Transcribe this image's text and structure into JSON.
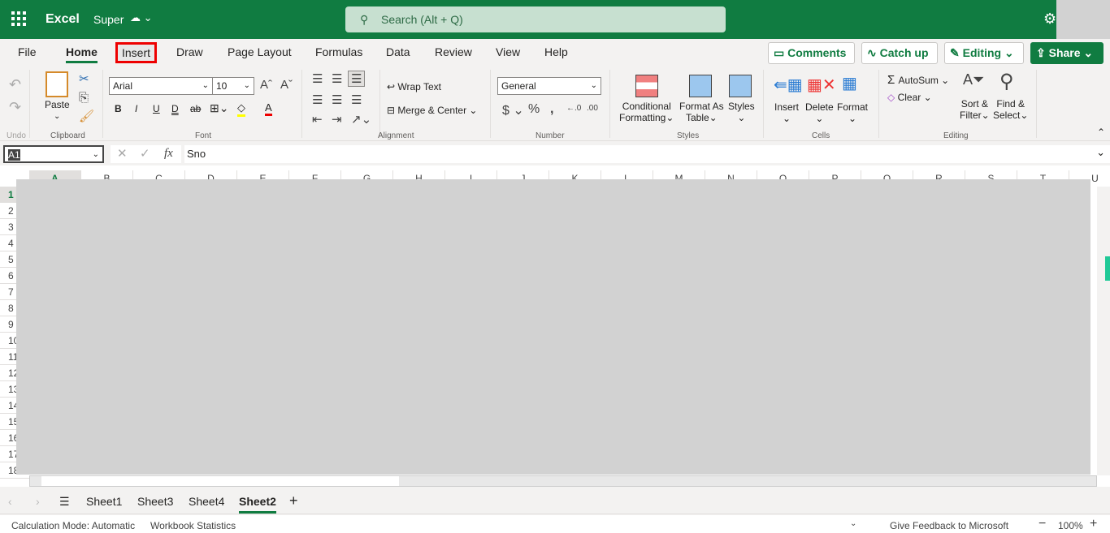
{
  "app": {
    "name": "Excel",
    "file": "Super",
    "search_placeholder": "Search (Alt + Q)"
  },
  "menu": [
    "File",
    "Home",
    "Insert",
    "Draw",
    "Page Layout",
    "Formulas",
    "Data",
    "Review",
    "View",
    "Help"
  ],
  "actions": {
    "comments": "Comments",
    "catchup": "Catch up",
    "editing": "Editing",
    "share": "Share"
  },
  "ribbon": {
    "groups": {
      "undo": "Undo",
      "clipboard": "Clipboard",
      "font": "Font",
      "alignment": "Alignment",
      "number": "Number",
      "styles": "Styles",
      "cells": "Cells",
      "editing": "Editing"
    },
    "paste": "Paste",
    "font_name": "Arial",
    "font_size": "10",
    "wrap": "Wrap Text",
    "merge": "Merge & Center",
    "number_format": "General",
    "cond1": "Conditional",
    "cond2": "Formatting",
    "fat1": "Format As",
    "fat2": "Table",
    "styles": "Styles",
    "insert": "Insert",
    "delete": "Delete",
    "format": "Format",
    "autosum": "AutoSum",
    "clear": "Clear",
    "sort1": "Sort &",
    "sort2": "Filter",
    "find1": "Find &",
    "find2": "Select",
    "highlight_color": "#ffff00",
    "font_color": "#ff0000"
  },
  "formula": {
    "name_box": "A1",
    "value": "Sno"
  },
  "columns": [
    "A",
    "B",
    "C",
    "D",
    "E",
    "F",
    "G",
    "H",
    "I",
    "J",
    "K",
    "L",
    "M",
    "N",
    "O",
    "P",
    "Q",
    "R",
    "S",
    "T",
    "U"
  ],
  "rows": [
    "1",
    "2",
    "3",
    "4",
    "5",
    "6",
    "7",
    "8",
    "9",
    "10",
    "11",
    "12",
    "13",
    "14",
    "15",
    "16",
    "17",
    "18"
  ],
  "sheets": [
    "Sheet1",
    "Sheet3",
    "Sheet4",
    "Sheet2"
  ],
  "active_sheet": "Sheet2",
  "status": {
    "calc": "Calculation Mode: Automatic",
    "stats": "Workbook Statistics",
    "feedback": "Give Feedback to Microsoft",
    "zoom": "100%"
  },
  "highlighted_tab": "Insert"
}
